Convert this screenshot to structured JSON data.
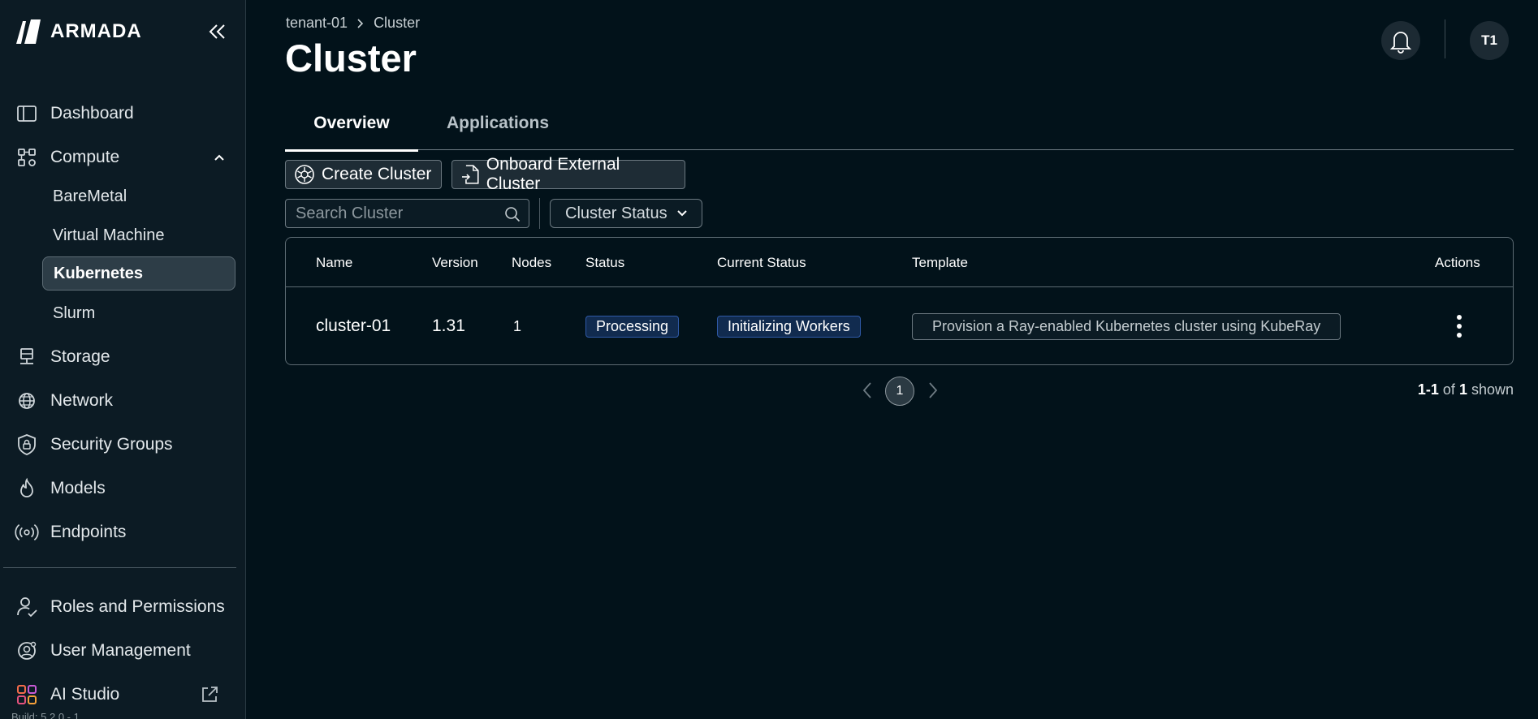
{
  "app": {
    "brand": "ARMADA",
    "build_text": "Build: 5.2.0 - 1"
  },
  "sidebar": {
    "items": [
      {
        "label": "Dashboard",
        "icon": "sidebar-panel-icon"
      },
      {
        "label": "Compute",
        "icon": "compute-nodes-icon",
        "expanded": true
      },
      {
        "label": "Storage",
        "icon": "storage-icon"
      },
      {
        "label": "Network",
        "icon": "globe-icon"
      },
      {
        "label": "Security Groups",
        "icon": "shield-lock-icon"
      },
      {
        "label": "Models",
        "icon": "flame-icon"
      },
      {
        "label": "Endpoints",
        "icon": "broadcast-icon"
      }
    ],
    "compute_children": [
      {
        "label": "BareMetal",
        "active": false
      },
      {
        "label": "Virtual Machine",
        "active": false
      },
      {
        "label": "Kubernetes",
        "active": true
      },
      {
        "label": "Slurm",
        "active": false
      }
    ],
    "bottom_items": [
      {
        "label": "Roles and Permissions",
        "icon": "user-check-icon"
      },
      {
        "label": "User Management",
        "icon": "user-gear-icon"
      },
      {
        "label": "AI Studio",
        "icon": "grid-apps-icon",
        "external": true
      }
    ]
  },
  "header": {
    "breadcrumb": [
      "tenant-01",
      "Cluster"
    ],
    "title": "Cluster",
    "avatar_initials": "T1"
  },
  "tabs": [
    {
      "label": "Overview",
      "active": true
    },
    {
      "label": "Applications",
      "active": false
    }
  ],
  "toolbar": {
    "create_label": "Create Cluster",
    "onboard_label": "Onboard External Cluster",
    "search_placeholder": "Search Cluster",
    "status_filter_label": "Cluster Status"
  },
  "table": {
    "columns": [
      "Name",
      "Version",
      "Nodes",
      "Status",
      "Current Status",
      "Template",
      "Actions"
    ],
    "rows": [
      {
        "name": "cluster-01",
        "version": "1.31",
        "nodes": "1",
        "status": "Processing",
        "current_status": "Initializing Workers",
        "template": "Provision a Ray-enabled Kubernetes cluster using KubeRay"
      }
    ]
  },
  "pagination": {
    "current_page": "1",
    "shown_range": "1-1",
    "shown_of": "of",
    "shown_total": "1",
    "shown_suffix": "shown"
  },
  "colors": {
    "background": "#02121a",
    "sidebar": "#0c1b24",
    "badge_bg": "#112b4f",
    "badge_border": "#2f5aa8"
  }
}
